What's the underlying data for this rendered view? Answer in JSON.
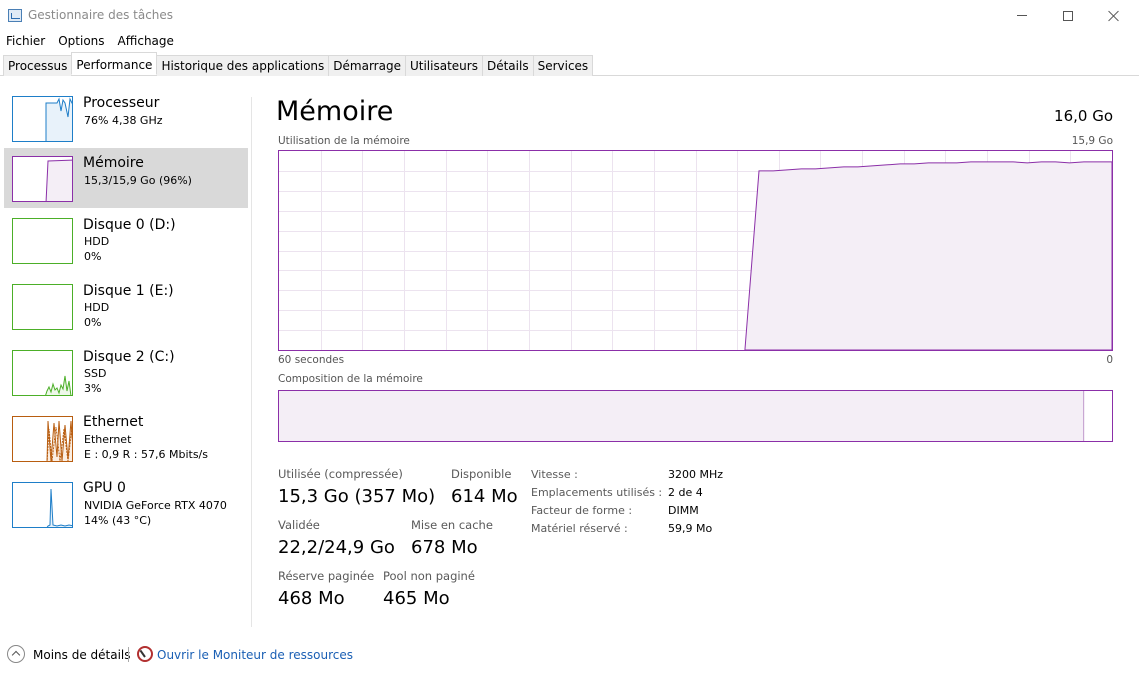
{
  "window": {
    "title": "Gestionnaire des tâches"
  },
  "menu": [
    "Fichier",
    "Options",
    "Affichage"
  ],
  "tabs": [
    "Processus",
    "Performance",
    "Historique des applications",
    "Démarrage",
    "Utilisateurs",
    "Détails",
    "Services"
  ],
  "active_tab": "Performance",
  "sidebar": {
    "items": [
      {
        "name": "Processeur",
        "line1": "76%  4,38 GHz",
        "line2": "",
        "color": "#1e7ec8",
        "selected": false
      },
      {
        "name": "Mémoire",
        "line1": "15,3/15,9 Go (96%)",
        "line2": "",
        "color": "#8b2fa8",
        "selected": true
      },
      {
        "name": "Disque 0 (D:)",
        "line1": "HDD",
        "line2": "0%",
        "color": "#4caf28",
        "selected": false
      },
      {
        "name": "Disque 1 (E:)",
        "line1": "HDD",
        "line2": "0%",
        "color": "#4caf28",
        "selected": false
      },
      {
        "name": "Disque 2 (C:)",
        "line1": "SSD",
        "line2": "3%",
        "color": "#4caf28",
        "selected": false
      },
      {
        "name": "Ethernet",
        "line1": "Ethernet",
        "line2": "E : 0,9  R : 57,6 Mbits/s",
        "color": "#b85d10",
        "selected": false
      },
      {
        "name": "GPU 0",
        "line1": "NVIDIA GeForce RTX 4070",
        "line2": "14%  (43 °C)",
        "color": "#1e7ec8",
        "selected": false
      }
    ]
  },
  "main": {
    "title": "Mémoire",
    "total": "16,0 Go",
    "usage_label": "Utilisation de la mémoire",
    "usage_max": "15,9 Go",
    "time_left": "60 secondes",
    "time_right": "0",
    "composition_label": "Composition de la mémoire",
    "accent_color": "#8b2fa8",
    "fill_color": "#f4eef6",
    "composition_in_use_fraction": 0.96,
    "usage_history_fraction": [
      0,
      0,
      0,
      0,
      0,
      0,
      0,
      0,
      0,
      0,
      0,
      0,
      0,
      0,
      0,
      0,
      0,
      0,
      0,
      0,
      0,
      0,
      0,
      0,
      0,
      0,
      0,
      0,
      0,
      0,
      0,
      0,
      0,
      0,
      0.9,
      0.9,
      0.905,
      0.91,
      0.91,
      0.915,
      0.92,
      0.92,
      0.925,
      0.93,
      0.935,
      0.935,
      0.94,
      0.94,
      0.94,
      0.945,
      0.945,
      0.945,
      0.945,
      0.94,
      0.945,
      0.945,
      0.94,
      0.945,
      0.945,
      0.945
    ],
    "stats": {
      "in_use_label": "Utilisée (compressée)",
      "in_use_value": "15,3 Go (357 Mo)",
      "available_label": "Disponible",
      "available_value": "614 Mo",
      "committed_label": "Validée",
      "committed_value": "22,2/24,9 Go",
      "cached_label": "Mise en cache",
      "cached_value": "678 Mo",
      "paged_label": "Réserve paginée",
      "paged_value": "468 Mo",
      "nonpaged_label": "Pool non paginé",
      "nonpaged_value": "465 Mo"
    },
    "details": [
      {
        "key": "Vitesse :",
        "value": "3200 MHz"
      },
      {
        "key": "Emplacements utilisés :",
        "value": "2 de 4"
      },
      {
        "key": "Facteur de forme :",
        "value": "DIMM"
      },
      {
        "key": "Matériel réservé :",
        "value": "59,9 Mo"
      }
    ]
  },
  "footer": {
    "less_details": "Moins de détails",
    "resource_monitor": "Ouvrir le Moniteur de ressources"
  }
}
